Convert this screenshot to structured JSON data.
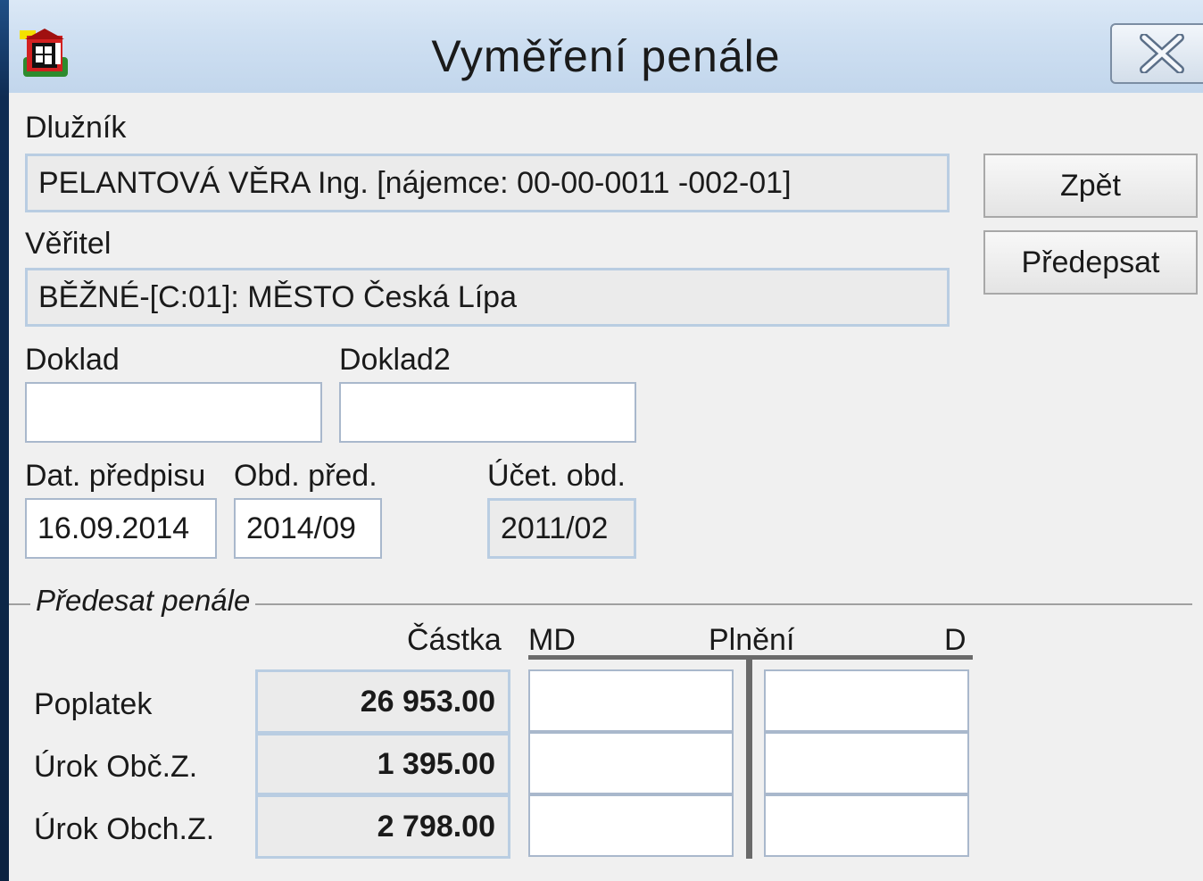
{
  "window": {
    "title": "Vyměření penále",
    "app_icon": "building-icon",
    "close_icon": "close-icon"
  },
  "debtor": {
    "label": "Dlužník",
    "value": "PELANTOVÁ VĚRA Ing. [nájemce: 00-00-0011 -002-01]"
  },
  "creditor": {
    "label": "Věřitel",
    "value": "BĚŽNÉ-[C:01]: MĚSTO Česká Lípa"
  },
  "doklad": {
    "label": "Doklad",
    "value": ""
  },
  "doklad2": {
    "label": "Doklad2",
    "value": ""
  },
  "dat_predpisu": {
    "label": "Dat. předpisu",
    "value": "16.09.2014"
  },
  "obd_pred": {
    "label": "Obd. před.",
    "value": "2014/09"
  },
  "ucet_obd": {
    "label": "Účet. obd.",
    "value": "2011/02"
  },
  "buttons": {
    "back": "Zpět",
    "prescribe": "Předepsat"
  },
  "penalty_section": {
    "title": "Předesat penále",
    "headers": {
      "amount": "Částka",
      "md": "MD",
      "plneni": "Plnění",
      "d": "D"
    },
    "rows": [
      {
        "label": "Poplatek",
        "amount": "26 953.00",
        "md": "",
        "d": ""
      },
      {
        "label": "Úrok Obč.Z.",
        "amount": "1 395.00",
        "md": "",
        "d": ""
      },
      {
        "label": "Úrok Obch.Z.",
        "amount": "2 798.00",
        "md": "",
        "d": ""
      }
    ]
  }
}
